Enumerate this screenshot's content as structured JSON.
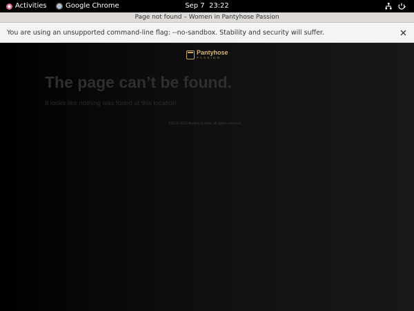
{
  "topbar": {
    "activities_label": "Activities",
    "app_name": "Google Chrome",
    "clock_date": "Sep 7",
    "clock_time": "23:22",
    "icons": [
      "gnome-activities-icon",
      "chrome-icon",
      "network-icon",
      "power-icon"
    ]
  },
  "window": {
    "title": "Page not found – Women in Pantyhose Passion"
  },
  "infobar": {
    "message": "You are using an unsupported command-line flag: --no-sandbox. Stability and security will suffer.",
    "close_icon": "close-icon"
  },
  "page": {
    "logo_main": "Pantyhose",
    "logo_sub": "PASSION",
    "heading": "The page can’t be found.",
    "message": "It looks like nothing was found at this location.",
    "copyright": "©2018-2023 Anatoly Eremin. all rights reserved."
  },
  "colors": {
    "background": "#000000",
    "brand_gold": "#d8b47a",
    "titlebar": "#dedbd8",
    "infobar": "#f4f4f4"
  }
}
